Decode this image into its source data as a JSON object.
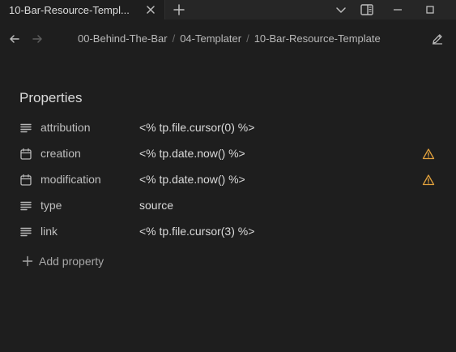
{
  "tab": {
    "title": "10-Bar-Resource-Templ...",
    "close_icon": "close-icon",
    "new_tab_icon": "plus-icon"
  },
  "window_controls": [
    "chevron-down-icon",
    "sidebar-toggle-icon",
    "minimize-icon",
    "maximize-icon"
  ],
  "breadcrumb": {
    "items": [
      "00-Behind-The-Bar",
      "04-Templater",
      "10-Bar-Resource-Template"
    ],
    "separator": "/"
  },
  "properties": {
    "heading": "Properties",
    "rows": [
      {
        "key": "attribution",
        "value": "<% tp.file.cursor(0) %>",
        "icon": "text-lines-icon",
        "warning": false
      },
      {
        "key": "creation",
        "value": "<% tp.date.now() %>",
        "icon": "calendar-icon",
        "warning": true
      },
      {
        "key": "modification",
        "value": "<% tp.date.now() %>",
        "icon": "calendar-icon",
        "warning": true
      },
      {
        "key": "type",
        "value": "source",
        "icon": "text-lines-icon",
        "warning": false
      },
      {
        "key": "link",
        "value": "<% tp.file.cursor(3) %>",
        "icon": "text-lines-icon",
        "warning": false
      }
    ],
    "add_label": "Add property"
  },
  "colors": {
    "background": "#1e1e1e",
    "titlebar": "#262626",
    "warning": "#e0a03c",
    "text": "#dadada"
  }
}
